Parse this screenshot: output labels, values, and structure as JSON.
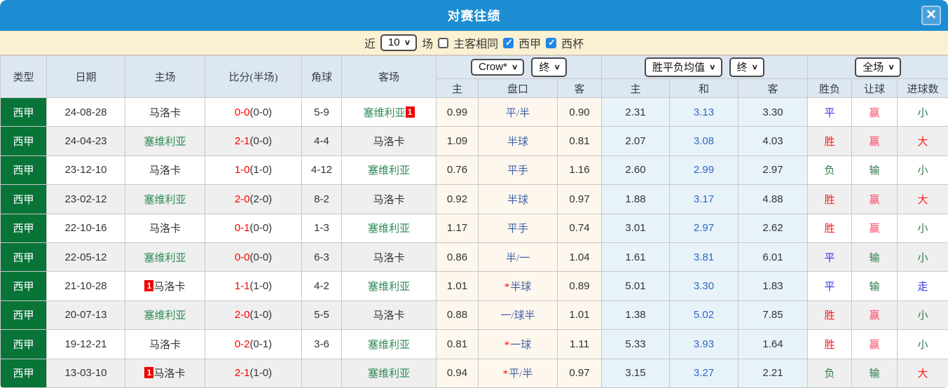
{
  "title_bar": {
    "title": "对赛往绩",
    "close_icon": "✕"
  },
  "filters": {
    "near_label": "近",
    "count_value": "10",
    "games_label": "场",
    "same_venue_label": "主客相同",
    "same_venue_checked": false,
    "league_label": "西甲",
    "league_checked": true,
    "cup_label": "西杯",
    "cup_checked": true
  },
  "colors": {
    "titlebar_blue": "#1c8dd2",
    "filter_cream": "#faf0d2",
    "header_bg": "#dde7f2",
    "league_green": "#087438",
    "odds_cream_bg": "#fdf7ed",
    "avg_blue_bg": "#e8f3f9",
    "team_green": "#2e8b57",
    "score_red": "#fe0000",
    "handicap_blue": "#4161a8",
    "draw_odds_blue": "#3168c4",
    "win_red": "#fe1a1a",
    "cover_pink": "#fb4a6a",
    "draw_blue": "#3333ee",
    "lose_green": "#2f7a4a"
  },
  "header": {
    "type": "类型",
    "date": "日期",
    "home": "主场",
    "score": "比分(半场)",
    "corner": "角球",
    "away": "客场",
    "dropdowns": {
      "odds_source": "Crow*",
      "odds_final": "终",
      "avg": "胜平负均值",
      "avg_final": "终",
      "scope": "全场"
    },
    "sub": {
      "home": "主",
      "handicap": "盘口",
      "away": "客",
      "avg_home": "主",
      "avg_draw": "和",
      "avg_away": "客",
      "wdl": "胜负",
      "handicap_result": "让球",
      "goals": "进球数"
    }
  },
  "rows": [
    {
      "league": "西甲",
      "date": "24-08-28",
      "home": {
        "name": "马洛卡",
        "green": false,
        "red_card": null
      },
      "score": "0-0",
      "half": "(0-0)",
      "corner": "5-9",
      "away": {
        "name": "塞维利亚",
        "green": true,
        "red_card": "1"
      },
      "odds": {
        "home": "0.99",
        "handicap": "平/半",
        "star": false,
        "away": "0.90"
      },
      "avg": {
        "home": "2.31",
        "draw": "3.13",
        "away": "3.30"
      },
      "result": {
        "wdl": "平",
        "wdl_color": "blue",
        "handicap": "赢",
        "handicap_color": "pink",
        "goals": "小",
        "goals_color": "green"
      }
    },
    {
      "league": "西甲",
      "date": "24-04-23",
      "home": {
        "name": "塞维利亚",
        "green": true,
        "red_card": null
      },
      "score": "2-1",
      "half": "(0-0)",
      "corner": "4-4",
      "away": {
        "name": "马洛卡",
        "green": false,
        "red_card": null
      },
      "odds": {
        "home": "1.09",
        "handicap": "半球",
        "star": false,
        "away": "0.81"
      },
      "avg": {
        "home": "2.07",
        "draw": "3.08",
        "away": "4.03"
      },
      "result": {
        "wdl": "胜",
        "wdl_color": "red",
        "handicap": "赢",
        "handicap_color": "pink",
        "goals": "大",
        "goals_color": "red"
      }
    },
    {
      "league": "西甲",
      "date": "23-12-10",
      "home": {
        "name": "马洛卡",
        "green": false,
        "red_card": null
      },
      "score": "1-0",
      "half": "(1-0)",
      "corner": "4-12",
      "away": {
        "name": "塞维利亚",
        "green": true,
        "red_card": null
      },
      "odds": {
        "home": "0.76",
        "handicap": "平手",
        "star": false,
        "away": "1.16"
      },
      "avg": {
        "home": "2.60",
        "draw": "2.99",
        "away": "2.97"
      },
      "result": {
        "wdl": "负",
        "wdl_color": "green",
        "handicap": "输",
        "handicap_color": "green",
        "goals": "小",
        "goals_color": "green"
      }
    },
    {
      "league": "西甲",
      "date": "23-02-12",
      "home": {
        "name": "塞维利亚",
        "green": true,
        "red_card": null
      },
      "score": "2-0",
      "half": "(2-0)",
      "corner": "8-2",
      "away": {
        "name": "马洛卡",
        "green": false,
        "red_card": null
      },
      "odds": {
        "home": "0.92",
        "handicap": "半球",
        "star": false,
        "away": "0.97"
      },
      "avg": {
        "home": "1.88",
        "draw": "3.17",
        "away": "4.88"
      },
      "result": {
        "wdl": "胜",
        "wdl_color": "red",
        "handicap": "赢",
        "handicap_color": "pink",
        "goals": "大",
        "goals_color": "red"
      }
    },
    {
      "league": "西甲",
      "date": "22-10-16",
      "home": {
        "name": "马洛卡",
        "green": false,
        "red_card": null
      },
      "score": "0-1",
      "half": "(0-0)",
      "corner": "1-3",
      "away": {
        "name": "塞维利亚",
        "green": true,
        "red_card": null
      },
      "odds": {
        "home": "1.17",
        "handicap": "平手",
        "star": false,
        "away": "0.74"
      },
      "avg": {
        "home": "3.01",
        "draw": "2.97",
        "away": "2.62"
      },
      "result": {
        "wdl": "胜",
        "wdl_color": "red",
        "handicap": "赢",
        "handicap_color": "pink",
        "goals": "小",
        "goals_color": "green"
      }
    },
    {
      "league": "西甲",
      "date": "22-05-12",
      "home": {
        "name": "塞维利亚",
        "green": true,
        "red_card": null
      },
      "score": "0-0",
      "half": "(0-0)",
      "corner": "6-3",
      "away": {
        "name": "马洛卡",
        "green": false,
        "red_card": null
      },
      "odds": {
        "home": "0.86",
        "handicap": "半/一",
        "star": false,
        "away": "1.04"
      },
      "avg": {
        "home": "1.61",
        "draw": "3.81",
        "away": "6.01"
      },
      "result": {
        "wdl": "平",
        "wdl_color": "blue",
        "handicap": "输",
        "handicap_color": "green",
        "goals": "小",
        "goals_color": "green"
      }
    },
    {
      "league": "西甲",
      "date": "21-10-28",
      "home": {
        "name": "马洛卡",
        "green": false,
        "red_card": "1"
      },
      "score": "1-1",
      "half": "(1-0)",
      "corner": "4-2",
      "away": {
        "name": "塞维利亚",
        "green": true,
        "red_card": null
      },
      "odds": {
        "home": "1.01",
        "handicap": "半球",
        "star": true,
        "away": "0.89"
      },
      "avg": {
        "home": "5.01",
        "draw": "3.30",
        "away": "1.83"
      },
      "result": {
        "wdl": "平",
        "wdl_color": "blue",
        "handicap": "输",
        "handicap_color": "green",
        "goals": "走",
        "goals_color": "blue"
      }
    },
    {
      "league": "西甲",
      "date": "20-07-13",
      "home": {
        "name": "塞维利亚",
        "green": true,
        "red_card": null
      },
      "score": "2-0",
      "half": "(1-0)",
      "corner": "5-5",
      "away": {
        "name": "马洛卡",
        "green": false,
        "red_card": null
      },
      "odds": {
        "home": "0.88",
        "handicap": "一/球半",
        "star": false,
        "away": "1.01"
      },
      "avg": {
        "home": "1.38",
        "draw": "5.02",
        "away": "7.85"
      },
      "result": {
        "wdl": "胜",
        "wdl_color": "red",
        "handicap": "赢",
        "handicap_color": "pink",
        "goals": "小",
        "goals_color": "green"
      }
    },
    {
      "league": "西甲",
      "date": "19-12-21",
      "home": {
        "name": "马洛卡",
        "green": false,
        "red_card": null
      },
      "score": "0-2",
      "half": "(0-1)",
      "corner": "3-6",
      "away": {
        "name": "塞维利亚",
        "green": true,
        "red_card": null
      },
      "odds": {
        "home": "0.81",
        "handicap": "一球",
        "star": true,
        "away": "1.11"
      },
      "avg": {
        "home": "5.33",
        "draw": "3.93",
        "away": "1.64"
      },
      "result": {
        "wdl": "胜",
        "wdl_color": "red",
        "handicap": "赢",
        "handicap_color": "pink",
        "goals": "小",
        "goals_color": "green"
      }
    },
    {
      "league": "西甲",
      "date": "13-03-10",
      "home": {
        "name": "马洛卡",
        "green": false,
        "red_card": "1"
      },
      "score": "2-1",
      "half": "(1-0)",
      "corner": "",
      "away": {
        "name": "塞维利亚",
        "green": true,
        "red_card": null
      },
      "odds": {
        "home": "0.94",
        "handicap": "平/半",
        "star": true,
        "away": "0.97"
      },
      "avg": {
        "home": "3.15",
        "draw": "3.27",
        "away": "2.21"
      },
      "result": {
        "wdl": "负",
        "wdl_color": "green",
        "handicap": "输",
        "handicap_color": "green",
        "goals": "大",
        "goals_color": "red"
      }
    }
  ]
}
